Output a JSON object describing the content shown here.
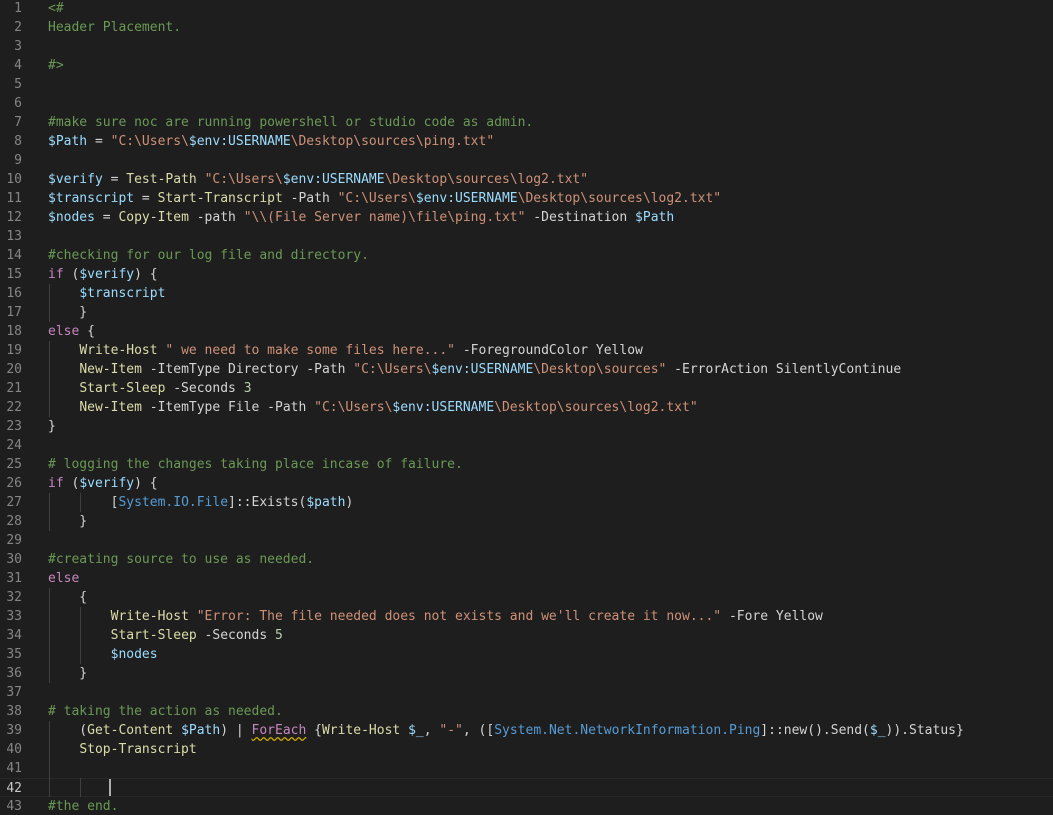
{
  "editor": {
    "language": "powershell",
    "theme": "dark",
    "cursor": {
      "line": 42
    },
    "lines": [
      {
        "n": "1",
        "tokens": [
          [
            "c-comment",
            "<#"
          ]
        ]
      },
      {
        "n": "2",
        "tokens": [
          [
            "c-comment",
            "Header Placement."
          ]
        ]
      },
      {
        "n": "3",
        "tokens": []
      },
      {
        "n": "4",
        "tokens": [
          [
            "c-comment",
            "#>"
          ]
        ]
      },
      {
        "n": "5",
        "tokens": []
      },
      {
        "n": "6",
        "tokens": []
      },
      {
        "n": "7",
        "tokens": [
          [
            "c-comment",
            "#make sure noc are running powershell or studio code as admin."
          ]
        ]
      },
      {
        "n": "8",
        "tokens": [
          [
            "c-var",
            "$Path"
          ],
          [
            "c-plain",
            " = "
          ],
          [
            "c-str",
            "\"C:\\Users\\"
          ],
          [
            "c-var",
            "$env:USERNAME"
          ],
          [
            "c-str",
            "\\Desktop\\sources\\ping.txt\""
          ]
        ]
      },
      {
        "n": "9",
        "tokens": []
      },
      {
        "n": "10",
        "tokens": [
          [
            "c-var",
            "$verify"
          ],
          [
            "c-plain",
            " = "
          ],
          [
            "c-fn",
            "Test-Path"
          ],
          [
            "c-plain",
            " "
          ],
          [
            "c-str",
            "\"C:\\Users\\"
          ],
          [
            "c-var",
            "$env:USERNAME"
          ],
          [
            "c-str",
            "\\Desktop\\sources\\log2.txt\""
          ]
        ]
      },
      {
        "n": "11",
        "tokens": [
          [
            "c-var",
            "$transcript"
          ],
          [
            "c-plain",
            " = "
          ],
          [
            "c-fn",
            "Start-Transcript"
          ],
          [
            "c-plain",
            " -Path "
          ],
          [
            "c-str",
            "\"C:\\Users\\"
          ],
          [
            "c-var",
            "$env:USERNAME"
          ],
          [
            "c-str",
            "\\Desktop\\sources\\log2.txt\""
          ]
        ]
      },
      {
        "n": "12",
        "tokens": [
          [
            "c-var",
            "$nodes"
          ],
          [
            "c-plain",
            " = "
          ],
          [
            "c-fn",
            "Copy-Item"
          ],
          [
            "c-plain",
            " -path "
          ],
          [
            "c-str",
            "\"\\\\(File Server name)\\file\\ping.txt\""
          ],
          [
            "c-plain",
            " -Destination "
          ],
          [
            "c-var",
            "$Path"
          ]
        ]
      },
      {
        "n": "13",
        "tokens": []
      },
      {
        "n": "14",
        "tokens": [
          [
            "c-comment",
            "#checking for our log file and directory."
          ]
        ]
      },
      {
        "n": "15",
        "tokens": [
          [
            "c-kw",
            "if"
          ],
          [
            "c-plain",
            " ("
          ],
          [
            "c-var",
            "$verify"
          ],
          [
            "c-plain",
            ") {"
          ]
        ]
      },
      {
        "n": "16",
        "tokens": [
          [
            "c-plain",
            "    "
          ],
          [
            "c-var",
            "$transcript"
          ]
        ]
      },
      {
        "n": "17",
        "tokens": [
          [
            "c-plain",
            "    }"
          ]
        ]
      },
      {
        "n": "18",
        "tokens": [
          [
            "c-kw",
            "else"
          ],
          [
            "c-plain",
            " {"
          ]
        ]
      },
      {
        "n": "19",
        "tokens": [
          [
            "c-plain",
            "    "
          ],
          [
            "c-fn",
            "Write-Host"
          ],
          [
            "c-plain",
            " "
          ],
          [
            "c-str",
            "\" we need to make some files here...\""
          ],
          [
            "c-plain",
            " -ForegroundColor Yellow"
          ]
        ]
      },
      {
        "n": "20",
        "tokens": [
          [
            "c-plain",
            "    "
          ],
          [
            "c-fn",
            "New-Item"
          ],
          [
            "c-plain",
            " -ItemType Directory -Path "
          ],
          [
            "c-str",
            "\"C:\\Users\\"
          ],
          [
            "c-var",
            "$env:USERNAME"
          ],
          [
            "c-str",
            "\\Desktop\\sources\""
          ],
          [
            "c-plain",
            " -ErrorAction SilentlyContinue"
          ]
        ]
      },
      {
        "n": "21",
        "tokens": [
          [
            "c-plain",
            "    "
          ],
          [
            "c-fn",
            "Start-Sleep"
          ],
          [
            "c-plain",
            " -Seconds "
          ],
          [
            "c-num",
            "3"
          ]
        ]
      },
      {
        "n": "22",
        "tokens": [
          [
            "c-plain",
            "    "
          ],
          [
            "c-fn",
            "New-Item"
          ],
          [
            "c-plain",
            " -ItemType File -Path "
          ],
          [
            "c-str",
            "\"C:\\Users\\"
          ],
          [
            "c-var",
            "$env:USERNAME"
          ],
          [
            "c-str",
            "\\Desktop\\sources\\log2.txt\""
          ]
        ]
      },
      {
        "n": "23",
        "tokens": [
          [
            "c-plain",
            "}"
          ]
        ]
      },
      {
        "n": "24",
        "tokens": []
      },
      {
        "n": "25",
        "tokens": [
          [
            "c-comment",
            "# logging the changes taking place incase of failure."
          ]
        ]
      },
      {
        "n": "26",
        "tokens": [
          [
            "c-kw",
            "if"
          ],
          [
            "c-plain",
            " ("
          ],
          [
            "c-var",
            "$verify"
          ],
          [
            "c-plain",
            ") {"
          ]
        ]
      },
      {
        "n": "27",
        "tokens": [
          [
            "c-plain",
            "        ["
          ],
          [
            "c-type2",
            "System.IO.File"
          ],
          [
            "c-plain",
            "]::Exists("
          ],
          [
            "c-var",
            "$path"
          ],
          [
            "c-plain",
            ")"
          ]
        ]
      },
      {
        "n": "28",
        "tokens": [
          [
            "c-plain",
            "    }"
          ]
        ]
      },
      {
        "n": "29",
        "tokens": []
      },
      {
        "n": "30",
        "tokens": [
          [
            "c-comment",
            "#creating source to use as needed."
          ]
        ]
      },
      {
        "n": "31",
        "tokens": [
          [
            "c-kw",
            "else"
          ]
        ]
      },
      {
        "n": "32",
        "tokens": [
          [
            "c-plain",
            "    {"
          ]
        ]
      },
      {
        "n": "33",
        "tokens": [
          [
            "c-plain",
            "        "
          ],
          [
            "c-fn",
            "Write-Host"
          ],
          [
            "c-plain",
            " "
          ],
          [
            "c-str",
            "\"Error: The file needed does not exists and we'll create it now...\""
          ],
          [
            "c-plain",
            " -Fore Yellow"
          ]
        ]
      },
      {
        "n": "34",
        "tokens": [
          [
            "c-plain",
            "        "
          ],
          [
            "c-fn",
            "Start-Sleep"
          ],
          [
            "c-plain",
            " -Seconds "
          ],
          [
            "c-num",
            "5"
          ]
        ]
      },
      {
        "n": "35",
        "tokens": [
          [
            "c-plain",
            "        "
          ],
          [
            "c-var",
            "$nodes"
          ]
        ]
      },
      {
        "n": "36",
        "tokens": [
          [
            "c-plain",
            "    }"
          ]
        ]
      },
      {
        "n": "37",
        "tokens": []
      },
      {
        "n": "38",
        "tokens": [
          [
            "c-comment",
            "# taking the action as needed."
          ]
        ]
      },
      {
        "n": "39",
        "tokens": [
          [
            "c-plain",
            "    ("
          ],
          [
            "c-fn",
            "Get-Content"
          ],
          [
            "c-plain",
            " "
          ],
          [
            "c-var",
            "$Path"
          ],
          [
            "c-plain",
            ") | "
          ],
          [
            "c-kw c-warn",
            "ForEach"
          ],
          [
            "c-plain",
            " {"
          ],
          [
            "c-fn",
            "Write-Host"
          ],
          [
            "c-plain",
            " "
          ],
          [
            "c-var",
            "$_"
          ],
          [
            "c-plain",
            ", "
          ],
          [
            "c-str",
            "\"-\""
          ],
          [
            "c-plain",
            ", (["
          ],
          [
            "c-type2",
            "System.Net.NetworkInformation.Ping"
          ],
          [
            "c-plain",
            "]::new().Send("
          ],
          [
            "c-var",
            "$_"
          ],
          [
            "c-plain",
            ")).Status}"
          ]
        ]
      },
      {
        "n": "40",
        "tokens": [
          [
            "c-plain",
            "    "
          ],
          [
            "c-fn",
            "Stop-Transcript"
          ]
        ]
      },
      {
        "n": "41",
        "tokens": []
      },
      {
        "n": "42",
        "tokens": []
      },
      {
        "n": "43",
        "tokens": [
          [
            "c-comment",
            "#the end."
          ]
        ]
      }
    ]
  }
}
